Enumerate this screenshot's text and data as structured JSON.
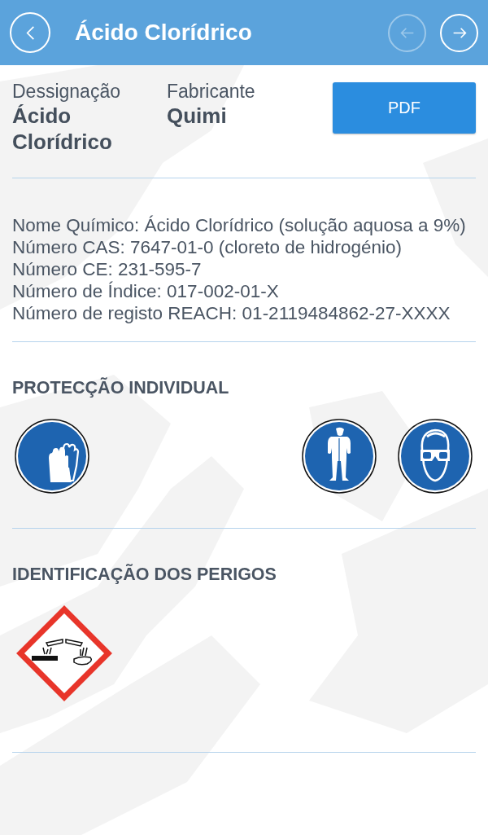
{
  "header": {
    "title": "Ácido Clorídrico",
    "back": {
      "disabled": false
    },
    "prev": {
      "disabled": true
    },
    "next": {
      "disabled": false
    }
  },
  "summary": [
    {
      "label": "Dessignação",
      "value": "Ácido Clorídrico"
    },
    {
      "label": "Fabricante",
      "value": "Quimi"
    }
  ],
  "pdf_button": "PDF",
  "details": [
    "Nome Químico: Ácido Clorídrico (solução aquosa a 9%)",
    "Número CAS: 7647-01-0 (cloreto de hidrogénio)",
    "Número CE: 231-595-7",
    "Número de Índice: 017-002-01-X",
    "Número de registo REACH: 01-2119484862-27-XXXX"
  ],
  "protection": {
    "heading": "PROTECÇÃO INDIVIDUAL",
    "icons": [
      {
        "kind": "gloves"
      },
      {
        "kind": "suit"
      },
      {
        "kind": "goggles"
      }
    ]
  },
  "hazards": {
    "heading": "IDENTIFICAÇÃO DOS PERIGOS",
    "pictograms": [
      {
        "kind": "corrosive"
      }
    ]
  }
}
